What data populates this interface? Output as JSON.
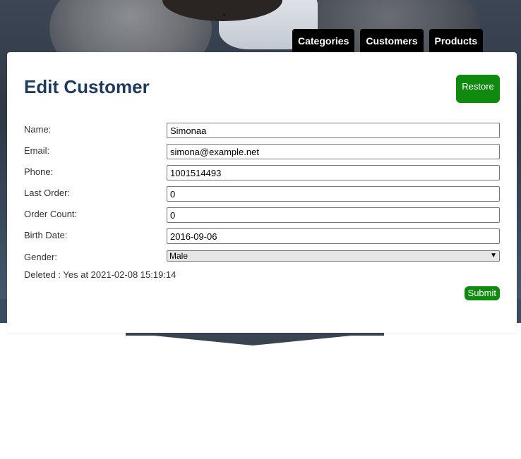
{
  "nav": {
    "tabs": [
      "Categories",
      "Customers",
      "Products"
    ]
  },
  "page": {
    "title": "Edit Customer",
    "restore_label": "Restore",
    "submit_label": "Submit",
    "deleted_text": "Deleted : Yes at 2021-02-08 15:19:14"
  },
  "form": {
    "name_label": "Name:",
    "name_value": "Simonaa",
    "email_label": "Email:",
    "email_value": "simona@example.net",
    "phone_label": "Phone:",
    "phone_value": "1001514493",
    "last_order_label": "Last Order:",
    "last_order_value": "0",
    "order_count_label": "Order Count:",
    "order_count_value": "0",
    "birth_date_label": "Birth Date:",
    "birth_date_value": "2016-09-06",
    "gender_label": "Gender:",
    "gender_value": "Male"
  },
  "icons": {
    "select_arrow": "chevron-down-icon"
  },
  "colors": {
    "accent_green": "#0f8a0f",
    "title_blue": "#1e3a5c",
    "nav_black": "#000000"
  }
}
